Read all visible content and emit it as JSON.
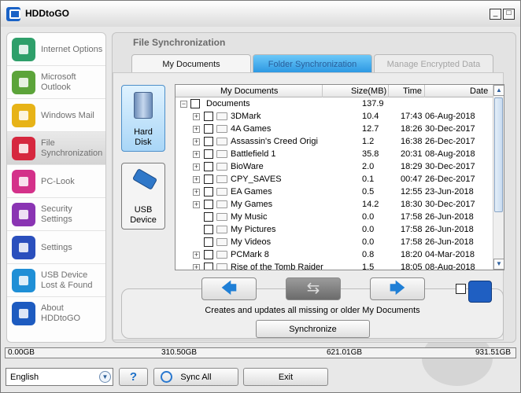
{
  "app": {
    "title": "HDDtoGO",
    "minimize_glyph": "_",
    "maximize_glyph": "□"
  },
  "sidebar": {
    "items": [
      {
        "label": "Internet Options",
        "icon": "globe-icon",
        "color": "#2e9f6a"
      },
      {
        "label": "Microsoft Outlook",
        "icon": "outlook-icon",
        "color": "#5ca43a"
      },
      {
        "label": "Windows Mail",
        "icon": "mail-icon",
        "color": "#e7b317"
      },
      {
        "label": "File Synchronization",
        "icon": "sync-files-icon",
        "color": "#d6283f"
      },
      {
        "label": "PC-Look",
        "icon": "key-icon",
        "color": "#d4318a"
      },
      {
        "label": "Security Settings",
        "icon": "lock-icon",
        "color": "#8a34b3"
      },
      {
        "label": "Settings",
        "icon": "gears-icon",
        "color": "#2a4fbd"
      },
      {
        "label": "USB Device Lost & Found",
        "icon": "usb-search-icon",
        "color": "#1f8fd6"
      },
      {
        "label": "About HDDtoGO",
        "icon": "about-icon",
        "color": "#1d5bc0"
      }
    ],
    "active_index": 3
  },
  "main": {
    "section_title": "File Synchronization",
    "tabs": [
      {
        "label": "My Documents"
      },
      {
        "label": "Folder Synchronization"
      },
      {
        "label": "Manage Encrypted Data"
      }
    ],
    "targets": [
      {
        "label1": "Hard",
        "label2": "Disk",
        "icon": "hard-disk-icon",
        "selected": true
      },
      {
        "label1": "USB",
        "label2": "Device",
        "icon": "usb-drive-icon",
        "selected": false
      }
    ],
    "list": {
      "columns": [
        "My Documents",
        "Size(MB)",
        "Time",
        "Date"
      ],
      "root": {
        "name": "Documents",
        "size": "137.9"
      },
      "rows": [
        {
          "name": "3DMark",
          "size": "10.4",
          "time": "17:43",
          "date": "06-Aug-2018",
          "expandable": true
        },
        {
          "name": "4A Games",
          "size": "12.7",
          "time": "18:26",
          "date": "30-Dec-2017",
          "expandable": true
        },
        {
          "name": "Assassin's Creed Origi",
          "size": "1.2",
          "time": "16:38",
          "date": "26-Dec-2017",
          "expandable": true
        },
        {
          "name": "Battlefield 1",
          "size": "35.8",
          "time": "20:31",
          "date": "08-Aug-2018",
          "expandable": true
        },
        {
          "name": "BioWare",
          "size": "2.0",
          "time": "18:29",
          "date": "30-Dec-2017",
          "expandable": true
        },
        {
          "name": "CPY_SAVES",
          "size": "0.1",
          "time": "00:47",
          "date": "26-Dec-2017",
          "expandable": true
        },
        {
          "name": "EA Games",
          "size": "0.5",
          "time": "12:55",
          "date": "23-Jun-2018",
          "expandable": true
        },
        {
          "name": "My Games",
          "size": "14.2",
          "time": "18:30",
          "date": "30-Dec-2017",
          "expandable": true
        },
        {
          "name": "My Music",
          "size": "0.0",
          "time": "17:58",
          "date": "26-Jun-2018",
          "expandable": false
        },
        {
          "name": "My Pictures",
          "size": "0.0",
          "time": "17:58",
          "date": "26-Jun-2018",
          "expandable": false
        },
        {
          "name": "My Videos",
          "size": "0.0",
          "time": "17:58",
          "date": "26-Jun-2018",
          "expandable": false
        },
        {
          "name": "PCMark 8",
          "size": "0.8",
          "time": "18:20",
          "date": "04-Mar-2018",
          "expandable": true
        },
        {
          "name": "Rise of the Tomb Raider",
          "size": "1.5",
          "time": "18:05",
          "date": "08-Aug-2018",
          "expandable": true
        }
      ]
    },
    "nav": {
      "prev_glyph": "🡄",
      "both_glyph": "⇆",
      "next_glyph": "🡆"
    },
    "description": "Creates and updates all missing or older My Documents",
    "sync_label": "Synchronize"
  },
  "storage": {
    "labels": [
      "0.00GB",
      "310.50GB",
      "621.01GB",
      "931.51GB"
    ],
    "used_fraction": 0.0
  },
  "bottom": {
    "language": "English",
    "help_label": "?",
    "sync_all_label": "Sync All",
    "exit_label": "Exit"
  },
  "colors": {
    "accent": "#2a96e2",
    "brand": "#1a62c6"
  }
}
